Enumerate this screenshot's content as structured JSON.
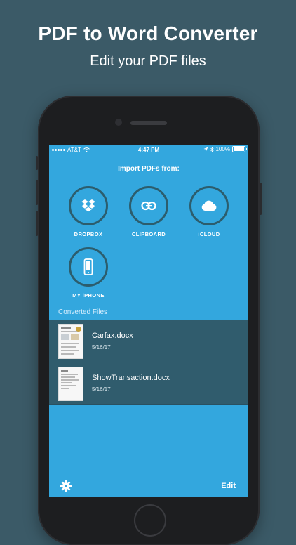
{
  "promo": {
    "headline": "PDF to Word Converter",
    "subline": "Edit your PDF files"
  },
  "statusbar": {
    "carrier": "AT&T",
    "time": "4:47 PM",
    "battery": "100%"
  },
  "import": {
    "title": "Import PDFs from:",
    "sources": [
      {
        "label": "DROPBOX",
        "icon": "dropbox-icon"
      },
      {
        "label": "CLIPBOARD",
        "icon": "link-icon"
      },
      {
        "label": "iCLOUD",
        "icon": "cloud-icon"
      },
      {
        "label": "MY iPHONE",
        "icon": "phone-icon"
      }
    ]
  },
  "converted": {
    "header": "Converted Files",
    "files": [
      {
        "name": "Carfax.docx",
        "date": "5/16/17"
      },
      {
        "name": "ShowTransaction.docx",
        "date": "5/16/17"
      }
    ]
  },
  "toolbar": {
    "settings_icon": "gear-icon",
    "edit_label": "Edit"
  },
  "colors": {
    "background": "#3b5a67",
    "screen": "#33a7de",
    "row": "#305c6d",
    "circle_border": "#2c5d6d"
  }
}
